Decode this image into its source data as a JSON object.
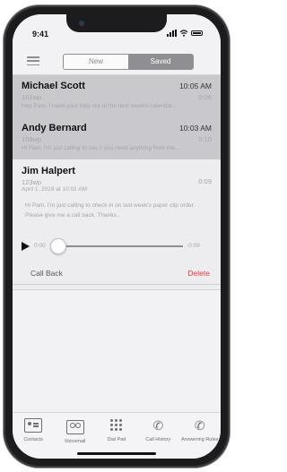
{
  "status_bar": {
    "time": "9:41"
  },
  "header": {
    "menu_icon": "hamburger-menu-icon",
    "tabs": [
      {
        "label": "New",
        "selected": false
      },
      {
        "label": "Saved",
        "selected": true
      }
    ]
  },
  "voicemails": [
    {
      "name": "Michael Scott",
      "time": "10:05 AM",
      "extension": "101wp",
      "duration": "0:06",
      "preview": "Hey Pam, I need your help out of the next week's calendar..."
    },
    {
      "name": "Andy Bernard",
      "time": "10:03 AM",
      "extension": "109wp",
      "duration": "0:10",
      "preview": "Hi Pam, I'm just calling to see if you need anything from me..."
    }
  ],
  "expanded": {
    "name": "Jim Halpert",
    "extension": "123wp",
    "duration": "0:09",
    "date": "April 1, 2019 at 10:01 AM",
    "transcript": "Hi Pam, I'm just calling to check in on last week's paper clip order. Please give me a call back. Thanks..",
    "player": {
      "elapsed": "0:00",
      "remaining": "-0:09",
      "progress": 0
    },
    "call_back_label": "Call Back",
    "delete_label": "Delete",
    "delete_color": "#e5383b"
  },
  "tab_bar": [
    {
      "label": "Contacts",
      "icon": "contacts-icon"
    },
    {
      "label": "Voicemail",
      "icon": "voicemail-icon"
    },
    {
      "label": "Dial Pad",
      "icon": "dial-pad-icon"
    },
    {
      "label": "Call History",
      "icon": "call-history-icon"
    },
    {
      "label": "Answering Rules",
      "icon": "answering-rules-icon"
    }
  ],
  "colors": {
    "accent_gray": "#8e8e93",
    "selected_row": "#c9c9cd",
    "delete_red": "#e5383b"
  }
}
